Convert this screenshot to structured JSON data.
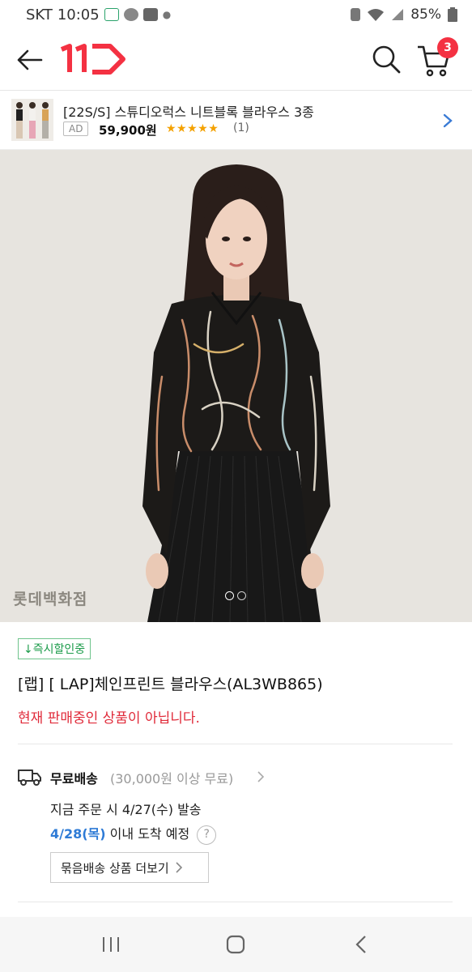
{
  "status_bar": {
    "carrier": "SKT",
    "time": "10:05",
    "battery": "85%"
  },
  "header": {
    "logo_text": "11",
    "cart_count": "3",
    "accent_color": "#f43142"
  },
  "ad": {
    "title": "[22S/S] 스튜디오럭스 니트블록 블라우스 3종",
    "tag": "AD",
    "price": "59,900원",
    "stars": "★★★★★",
    "review_count": "(1)"
  },
  "hero": {
    "watermark": "롯데백화점",
    "page_count": 2,
    "current_page": 1
  },
  "product": {
    "chip": "↓즉시할인중",
    "name": "[랩] [ LAP]체인프린트 블라우스(AL3WB865)",
    "status": "현재 판매중인 상품이 아닙니다."
  },
  "shipping": {
    "title": "무료배송",
    "condition": "(30,000원 이상 무료)",
    "order_line": "지금 주문 시 4/27(수) 발송",
    "arrival_date": "4/28(목)",
    "arrival_text": " 이내 도착 예정",
    "help": "?",
    "bundle_button": "묶음배송 상품 더보기"
  }
}
